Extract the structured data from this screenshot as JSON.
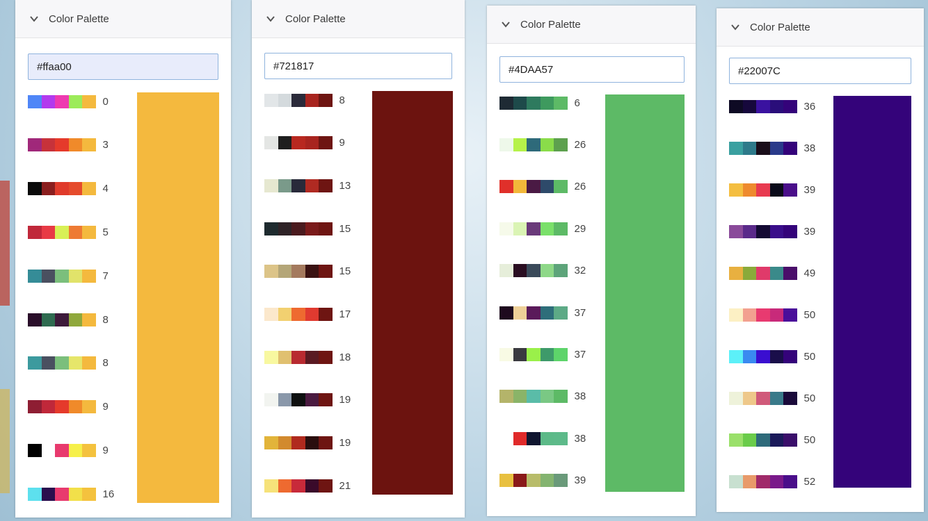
{
  "panels": [
    {
      "title": "Color Palette",
      "hex": "#ffaa00",
      "preview": "#F4B93E",
      "input_bg": "#e8ecfb",
      "rows": [
        {
          "colors": [
            "#4F86F7",
            "#B23AEE",
            "#EE3AB0",
            "#9CEB5A",
            "#F4B93E"
          ],
          "count": "0"
        },
        {
          "colors": [
            "#A0287A",
            "#C7323A",
            "#E53A2B",
            "#F08A2A",
            "#F4B93E"
          ],
          "count": "3"
        },
        {
          "colors": [
            "#0B0B0B",
            "#8A1E1E",
            "#E03A2A",
            "#E54B2C",
            "#F4B93E"
          ],
          "count": "4"
        },
        {
          "colors": [
            "#C0283A",
            "#E83A45",
            "#D8F056",
            "#EE7A33",
            "#F4B93E"
          ],
          "count": "5"
        },
        {
          "colors": [
            "#358C97",
            "#4A5060",
            "#7BBF7C",
            "#E1E36A",
            "#F4B93E"
          ],
          "count": "7"
        },
        {
          "colors": [
            "#2A0E2A",
            "#2F6B50",
            "#3D1A3A",
            "#8FA83C",
            "#F4B93E"
          ],
          "count": "8"
        },
        {
          "colors": [
            "#3C9A9E",
            "#4A5060",
            "#7BBF7C",
            "#E6E66A",
            "#F4B93E"
          ],
          "count": "8"
        },
        {
          "colors": [
            "#8E1E33",
            "#C0283A",
            "#E53A2B",
            "#F08A2A",
            "#F4B93E"
          ],
          "count": "9"
        },
        {
          "colors": [
            "#000000",
            "#FFFFFF",
            "#E83A6E",
            "#F6F04A",
            "#F4C23E"
          ],
          "count": "9"
        },
        {
          "colors": [
            "#5DE0EE",
            "#2A0E4E",
            "#E83A6E",
            "#F2E04A",
            "#F4C23E"
          ],
          "count": "16"
        }
      ]
    },
    {
      "title": "Color Palette",
      "hex": "#721817",
      "preview": "#6C130F",
      "input_bg": "#ffffff",
      "rows": [
        {
          "colors": [
            "#E2E6E8",
            "#D4DADD",
            "#2A2A3A",
            "#A8241F",
            "#6E1512"
          ],
          "count": "8"
        },
        {
          "colors": [
            "#E4E6E4",
            "#1E1E1E",
            "#B82820",
            "#A8241F",
            "#6E1512"
          ],
          "count": "9"
        },
        {
          "colors": [
            "#E6E8D0",
            "#7A9A8A",
            "#282A3A",
            "#B02A22",
            "#6E1512"
          ],
          "count": "13"
        },
        {
          "colors": [
            "#1E2A2E",
            "#2E2226",
            "#4A1A1E",
            "#7A1A1A",
            "#6E1512"
          ],
          "count": "15"
        },
        {
          "colors": [
            "#DCC488",
            "#B4A678",
            "#A47A5E",
            "#3A1212",
            "#6E1512"
          ],
          "count": "15"
        },
        {
          "colors": [
            "#FBE8CC",
            "#F2D070",
            "#EE6A30",
            "#E03A30",
            "#6E1512"
          ],
          "count": "17"
        },
        {
          "colors": [
            "#F8F8A0",
            "#E0C070",
            "#B82A30",
            "#5A1A22",
            "#6E1512"
          ],
          "count": "18"
        },
        {
          "colors": [
            "#F2F4F0",
            "#8A98AA",
            "#0E1010",
            "#4A1A40",
            "#6E1512"
          ],
          "count": "19"
        },
        {
          "colors": [
            "#E2B43A",
            "#D28A2E",
            "#B02A1E",
            "#2A0E0E",
            "#6E1512"
          ],
          "count": "19"
        },
        {
          "colors": [
            "#F6E27A",
            "#EE6A30",
            "#C82A3A",
            "#3A0A2A",
            "#6E1512"
          ],
          "count": "21"
        }
      ]
    },
    {
      "title": "Color Palette",
      "hex": "#4DAA57",
      "preview": "#5DBA66",
      "input_bg": "#ffffff",
      "rows": [
        {
          "colors": [
            "#1E2A34",
            "#1E4A4A",
            "#2E7A5E",
            "#3E9A5E",
            "#5DBA66"
          ],
          "count": "6"
        },
        {
          "colors": [
            "#EEF8EA",
            "#B6F24A",
            "#2E6A7A",
            "#8ADC4A",
            "#5DA04E"
          ],
          "count": "26"
        },
        {
          "colors": [
            "#E0302A",
            "#F2B83A",
            "#4A1A44",
            "#2E4A6A",
            "#5DBA66"
          ],
          "count": "26"
        },
        {
          "colors": [
            "#F6FAEA",
            "#DAF4B4",
            "#6A3A7A",
            "#7AE06A",
            "#5DBA66"
          ],
          "count": "29"
        },
        {
          "colors": [
            "#E6EEDA",
            "#2A0E22",
            "#3A4A5A",
            "#8ED888",
            "#5DA47A"
          ],
          "count": "32"
        },
        {
          "colors": [
            "#1E0A1E",
            "#EED098",
            "#5A1A5A",
            "#2E6E7A",
            "#5DAA86"
          ],
          "count": "37"
        },
        {
          "colors": [
            "#F8FAE4",
            "#3A3A40",
            "#9AF04A",
            "#3E9A6A",
            "#5DD46A"
          ],
          "count": "37"
        },
        {
          "colors": [
            "#B4B46A",
            "#8AB468",
            "#5ABCA8",
            "#7AC884",
            "#5DBA66"
          ],
          "count": "38"
        },
        {
          "colors": [
            "#FFFFFF",
            "#E02A2A",
            "#101630",
            "#5CBA88",
            "#5DBA8A"
          ],
          "count": "38"
        },
        {
          "colors": [
            "#E8C040",
            "#8A1A1A",
            "#B8BC6A",
            "#84B470",
            "#6A9A7A"
          ],
          "count": "39"
        }
      ]
    },
    {
      "title": "Color Palette",
      "hex": "#22007C",
      "preview": "#34037A",
      "input_bg": "#ffffff",
      "rows": [
        {
          "colors": [
            "#0E0A24",
            "#16083C",
            "#3A12A0",
            "#2A0E7A",
            "#34037A"
          ],
          "count": "36"
        },
        {
          "colors": [
            "#3AA0A0",
            "#2E7A8A",
            "#1A0E1A",
            "#2A3A8A",
            "#34037A"
          ],
          "count": "38"
        },
        {
          "colors": [
            "#F4BE40",
            "#EE8A2E",
            "#E83A50",
            "#0A0A1A",
            "#4A0E8A"
          ],
          "count": "39"
        },
        {
          "colors": [
            "#8A4A9A",
            "#5A2A8A",
            "#140A34",
            "#3A0E8A",
            "#34037A"
          ],
          "count": "39"
        },
        {
          "colors": [
            "#E8B040",
            "#8AAA3A",
            "#E03A6A",
            "#3A8A8A",
            "#4A0E6A"
          ],
          "count": "49"
        },
        {
          "colors": [
            "#FCF0C4",
            "#F2A090",
            "#E83A70",
            "#C82A7A",
            "#4A0E9A"
          ],
          "count": "50"
        },
        {
          "colors": [
            "#5CF0F8",
            "#3A8AF0",
            "#3A0ED0",
            "#1A0E4A",
            "#34037A"
          ],
          "count": "50"
        },
        {
          "colors": [
            "#EEF2DA",
            "#EEC88A",
            "#D05A7A",
            "#3A7A8A",
            "#1A0A3A"
          ],
          "count": "50"
        },
        {
          "colors": [
            "#9AE06A",
            "#6ACC4A",
            "#2E6A7A",
            "#1A1A5A",
            "#3A0E6A"
          ],
          "count": "50"
        },
        {
          "colors": [
            "#C8E0D0",
            "#E89A6A",
            "#A02A6A",
            "#7A1A8A",
            "#4A0E8A"
          ],
          "count": "52"
        }
      ]
    }
  ]
}
